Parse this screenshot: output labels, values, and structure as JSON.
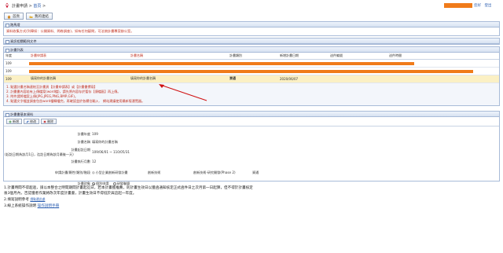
{
  "header": {
    "breadcrumb_prefix": "計畫申請 > ",
    "breadcrumb_link": "首頁",
    "breadcrumb_suffix": " >",
    "hello": "您好",
    "logout": "登出"
  },
  "toolbar": {
    "home_label": "首頁",
    "favorites_label": "我的連結"
  },
  "panels": {
    "news": {
      "title": "跑馬燈",
      "text": "資料收集方式(列舉如：公開資料、問卷調查)，如有任何疑問，可洽詢計畫專案辦公室。"
    },
    "downloads": {
      "title": "資訊相關範例文件"
    },
    "list": {
      "title": "計畫列表",
      "columns": [
        "年度",
        "計畫申請表",
        "計畫名稱",
        "計畫類別",
        "新增計畫日期",
        "送件編號",
        "送件時間"
      ],
      "rows": [
        {
          "year": "109",
          "redacted": true
        },
        {
          "year": "109",
          "redacted": true
        },
        {
          "year": "109",
          "form": "填寫你的計畫名稱",
          "name": "填寫你的計畫名稱",
          "category": "資通",
          "date": "2020/06/07",
          "highlight": true
        }
      ],
      "notes": [
        "1. 點選計畫名稱連結至計畫頁【計畫申請表】或【計畫書撰寫】",
        "2. 計畫書內容若有上傳檔案(word檔)，請先將內容存於暫存【傳檔區】再上傳。",
        "3. 附件請將檔案上傳(JPG,JPEG,PNG,BMP,GIF)。",
        "4. 點選文字檔並調查包含word檔轉檔完，再確認並於各欄位輸入．  網站建議使用最新版瀏覽器。"
      ]
    },
    "basic": {
      "title": "計畫書基本資料",
      "actions": {
        "add": "新增",
        "edit": "修改",
        "delete": "刪除"
      },
      "fields": {
        "year_label": "計畫年度",
        "year_value": "109",
        "name_label": "計畫名稱",
        "name_value": "填寫你的計畫名稱",
        "period_label": "計畫起訖日期",
        "period_sub": "(起訖日期為該月1日，迄訖日期為該月最後一天)",
        "period_value": "109/06/01 ~ 110/05/31",
        "months_label": "計畫執行月數",
        "months_value": "12",
        "type_label": "申請計畫/屬性/類別/階段",
        "type_value1": "小型企業創新研發計畫",
        "type_value2": "創新技術",
        "type_value3": "創新技術-研究開發(Phase 2)",
        "type_value4": "資通",
        "target_label": "計畫對象",
        "target_opt1": "個別申請",
        "target_opt2": "研發聯盟"
      }
    }
  },
  "footer": {
    "line1": "1.計畫時間不得超過，請以本整合之時間期間計畫起訖日，若本計畫獲推薦，則計畫生效日以獲函通知核定正式函件日之次月第一日起算，但不得於計畫核定",
    "line1b": "後3個月內，否認獲者作業將改次年度計畫書，計畫生效日不得低於與這起一年度。",
    "line2_prefix": "2.填寫說明參考 ",
    "line2_link": "請點選此處",
    "line3_prefix": "3.線上系統操作說明 ",
    "line3_link": "操作說明手冊"
  },
  "colors": {
    "accent": "#f07b1a",
    "highlight_row": "#fbf0c4",
    "link": "#2a5db0",
    "warning": "#c03020"
  }
}
